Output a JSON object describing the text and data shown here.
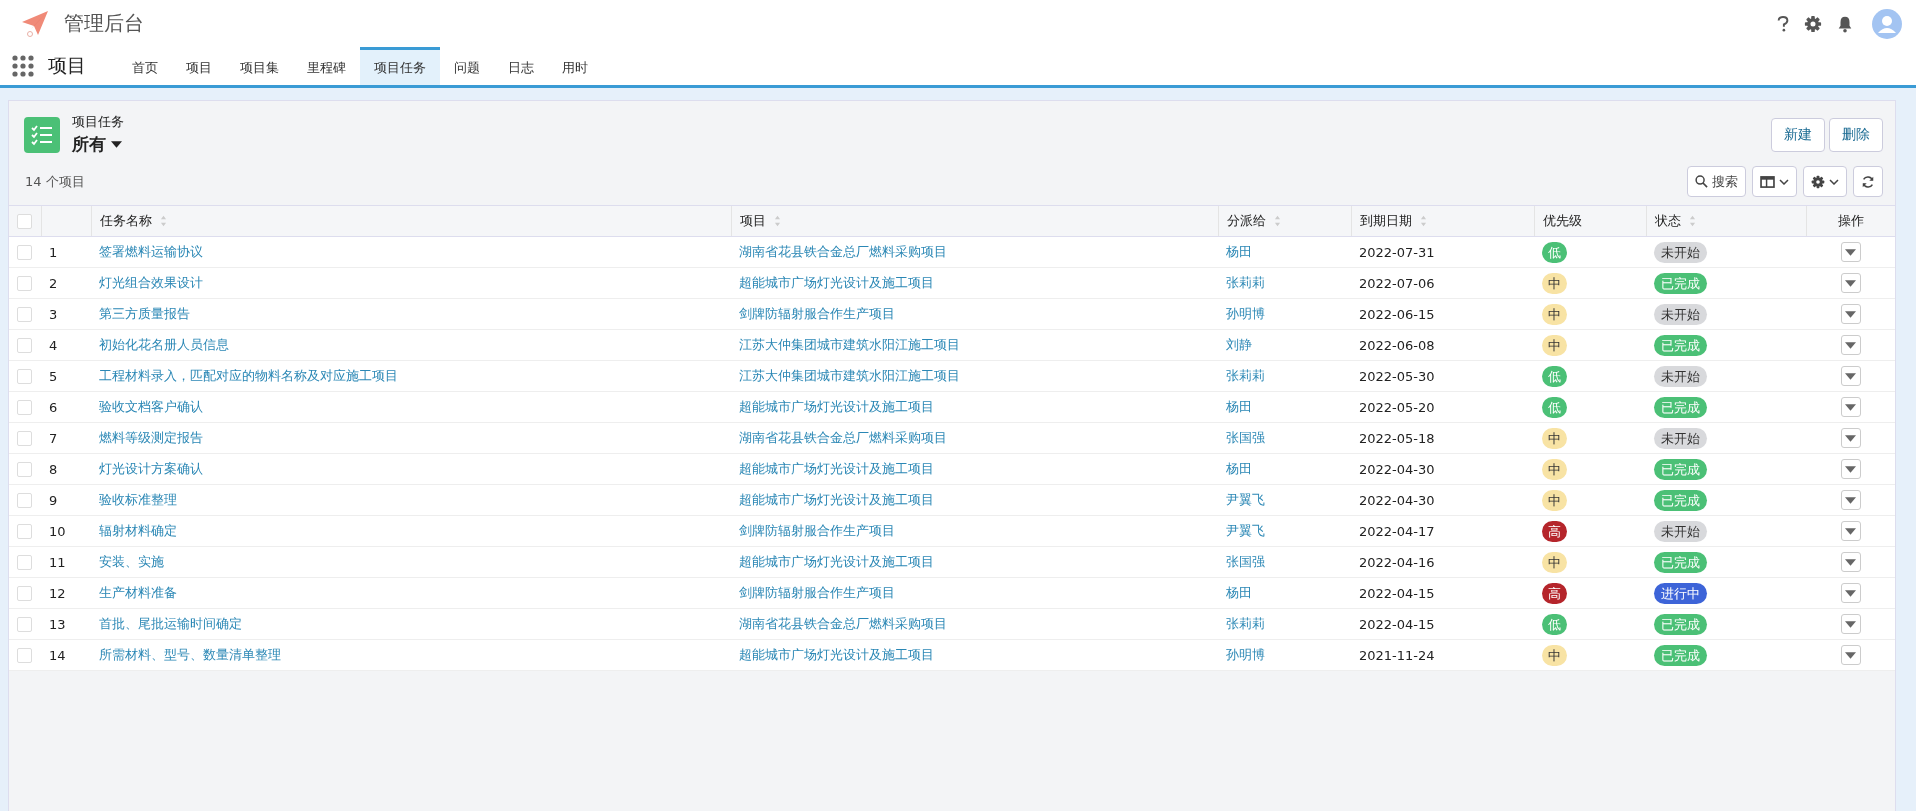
{
  "app": {
    "title": "管理后台"
  },
  "nav": {
    "module": "项目",
    "tabs": [
      {
        "label": "首页",
        "selected": false
      },
      {
        "label": "项目",
        "selected": false
      },
      {
        "label": "项目集",
        "selected": false
      },
      {
        "label": "里程碑",
        "selected": false
      },
      {
        "label": "项目任务",
        "selected": true
      },
      {
        "label": "问题",
        "selected": false
      },
      {
        "label": "日志",
        "selected": false
      },
      {
        "label": "用时",
        "selected": false
      }
    ]
  },
  "list_header": {
    "object": "项目任务",
    "view": "所有",
    "count": "14 个项目",
    "buttons": [
      "新建",
      "删除"
    ],
    "search_button": "搜索"
  },
  "table": {
    "select_all_checked": false,
    "columns": [
      {
        "label": "任务名称",
        "sortable": true
      },
      {
        "label": "项目",
        "sortable": true
      },
      {
        "label": "分派给",
        "sortable": true
      },
      {
        "label": "到期日期",
        "sortable": true
      },
      {
        "label": "优先级",
        "sortable": false
      },
      {
        "label": "状态",
        "sortable": true
      },
      {
        "label": "操作",
        "sortable": false
      }
    ],
    "rows": [
      {
        "checked": false,
        "number": "1",
        "name": "签署燃料运输协议",
        "project": "湖南省花县铁合金总厂燃料采购项目",
        "assignee": "杨田",
        "due": "2022-07-31",
        "priority": {
          "label": "低",
          "kind": "low"
        },
        "status": {
          "label": "未开始",
          "kind": "todo"
        }
      },
      {
        "checked": false,
        "number": "2",
        "name": "灯光组合效果设计",
        "project": "超能城市广场灯光设计及施工项目",
        "assignee": "张莉莉",
        "due": "2022-07-06",
        "priority": {
          "label": "中",
          "kind": "medium"
        },
        "status": {
          "label": "已完成",
          "kind": "done"
        }
      },
      {
        "checked": false,
        "number": "3",
        "name": "第三方质量报告",
        "project": "剑牌防辐射服合作生产项目",
        "assignee": "孙明博",
        "due": "2022-06-15",
        "priority": {
          "label": "中",
          "kind": "medium"
        },
        "status": {
          "label": "未开始",
          "kind": "todo"
        }
      },
      {
        "checked": false,
        "number": "4",
        "name": "初始化花名册人员信息",
        "project": "江苏大仲集团城市建筑水阳江施工项目",
        "assignee": "刘静",
        "due": "2022-06-08",
        "priority": {
          "label": "中",
          "kind": "medium"
        },
        "status": {
          "label": "已完成",
          "kind": "done"
        }
      },
      {
        "checked": false,
        "number": "5",
        "name": "工程材料录入，匹配对应的物料名称及对应施工项目",
        "project": "江苏大仲集团城市建筑水阳江施工项目",
        "assignee": "张莉莉",
        "due": "2022-05-30",
        "priority": {
          "label": "低",
          "kind": "low"
        },
        "status": {
          "label": "未开始",
          "kind": "todo"
        }
      },
      {
        "checked": false,
        "number": "6",
        "name": "验收文档客户确认",
        "project": "超能城市广场灯光设计及施工项目",
        "assignee": "杨田",
        "due": "2022-05-20",
        "priority": {
          "label": "低",
          "kind": "low"
        },
        "status": {
          "label": "已完成",
          "kind": "done"
        }
      },
      {
        "checked": false,
        "number": "7",
        "name": "燃料等级测定报告",
        "project": "湖南省花县铁合金总厂燃料采购项目",
        "assignee": "张国强",
        "due": "2022-05-18",
        "priority": {
          "label": "中",
          "kind": "medium"
        },
        "status": {
          "label": "未开始",
          "kind": "todo"
        }
      },
      {
        "checked": false,
        "number": "8",
        "name": "灯光设计方案确认",
        "project": "超能城市广场灯光设计及施工项目",
        "assignee": "杨田",
        "due": "2022-04-30",
        "priority": {
          "label": "中",
          "kind": "medium"
        },
        "status": {
          "label": "已完成",
          "kind": "done"
        }
      },
      {
        "checked": false,
        "number": "9",
        "name": "验收标准整理",
        "project": "超能城市广场灯光设计及施工项目",
        "assignee": "尹翼飞",
        "due": "2022-04-30",
        "priority": {
          "label": "中",
          "kind": "medium"
        },
        "status": {
          "label": "已完成",
          "kind": "done"
        }
      },
      {
        "checked": false,
        "number": "10",
        "name": "辐射材料确定",
        "project": "剑牌防辐射服合作生产项目",
        "assignee": "尹翼飞",
        "due": "2022-04-17",
        "priority": {
          "label": "高",
          "kind": "high"
        },
        "status": {
          "label": "未开始",
          "kind": "todo"
        }
      },
      {
        "checked": false,
        "number": "11",
        "name": "安装、实施",
        "project": "超能城市广场灯光设计及施工项目",
        "assignee": "张国强",
        "due": "2022-04-16",
        "priority": {
          "label": "中",
          "kind": "medium"
        },
        "status": {
          "label": "已完成",
          "kind": "done"
        }
      },
      {
        "checked": false,
        "number": "12",
        "name": "生产材料准备",
        "project": "剑牌防辐射服合作生产项目",
        "assignee": "杨田",
        "due": "2022-04-15",
        "priority": {
          "label": "高",
          "kind": "high"
        },
        "status": {
          "label": "进行中",
          "kind": "doing"
        }
      },
      {
        "checked": false,
        "number": "13",
        "name": "首批、尾批运输时间确定",
        "project": "湖南省花县铁合金总厂燃料采购项目",
        "assignee": "张莉莉",
        "due": "2022-04-15",
        "priority": {
          "label": "低",
          "kind": "low"
        },
        "status": {
          "label": "已完成",
          "kind": "done"
        }
      },
      {
        "checked": false,
        "number": "14",
        "name": "所需材料、型号、数量清单整理",
        "project": "超能城市广场灯光设计及施工项目",
        "assignee": "孙明博",
        "due": "2021-11-24",
        "priority": {
          "label": "中",
          "kind": "medium"
        },
        "status": {
          "label": "已完成",
          "kind": "done"
        }
      }
    ]
  }
}
